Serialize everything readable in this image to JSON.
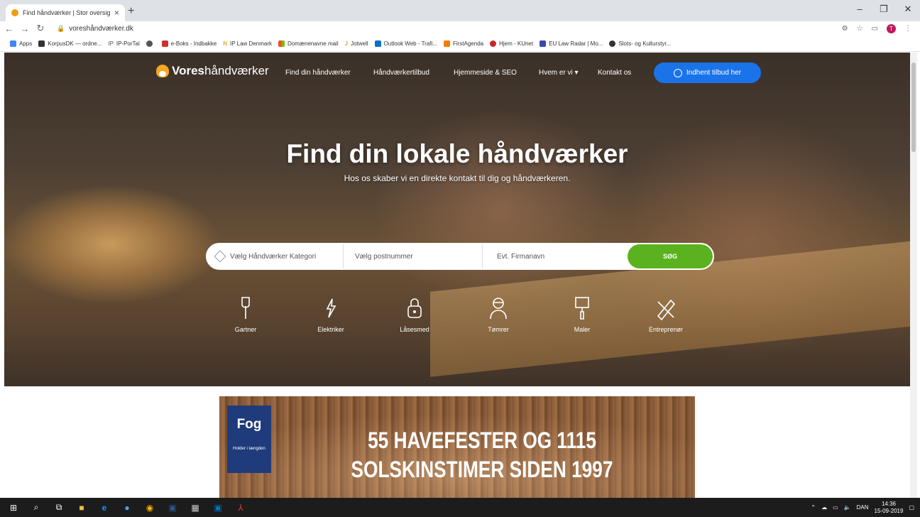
{
  "browser": {
    "tab_title": "Find håndværker | Stor oversigt o",
    "url": "voreshåndværker.dk",
    "profile_initial": "T"
  },
  "bookmarks": [
    "Apps",
    "KorpusDK — ordne...",
    "IP-PorTal",
    "",
    "e-Boks - Indbakke",
    "IP Law Denmark",
    "Domænenavne mail",
    "Jotwell",
    "Outlook Web - Trafi...",
    "FirstAgenda",
    "Hjem - KUnet",
    "EU Law Radar | Mo...",
    "Slots- og Kulturstyr..."
  ],
  "header": {
    "logo_bold": "Vores",
    "logo_rest": "håndværker",
    "nav": [
      "Find din håndværker",
      "Håndværkertilbud",
      "Hjemmeside & SEO",
      "Hvem er vi ▾",
      "Kontakt os"
    ],
    "cta": "Indhent tilbud her"
  },
  "hero": {
    "title": "Find din lokale håndværker",
    "subtitle": "Hos os skaber vi en direkte kontakt til dig og håndværkeren."
  },
  "search": {
    "category_placeholder": "Vælg Håndværker Kategori",
    "postal_placeholder": "Vælg postnummer",
    "company_placeholder": "Evt. Firmanavn",
    "button": "SØG"
  },
  "categories": [
    "Gartner",
    "Elektriker",
    "Låsesmed",
    "Tømrer",
    "Maler",
    "Entreprenør"
  ],
  "ad": {
    "brand": "Fog",
    "tagline": "Holder i længden",
    "line1": "55 HAVEFESTER OG 1115",
    "line2": "SOLSKINSTIMER  SIDEN 1997"
  },
  "taskbar": {
    "language": "DAN",
    "time": "14:36",
    "date": "15-09-2019"
  },
  "colors": {
    "cta_blue": "#1a73e8",
    "search_green": "#5ab31e",
    "fog_blue": "#1f3b7c",
    "logo_orange": "#f5a623"
  }
}
